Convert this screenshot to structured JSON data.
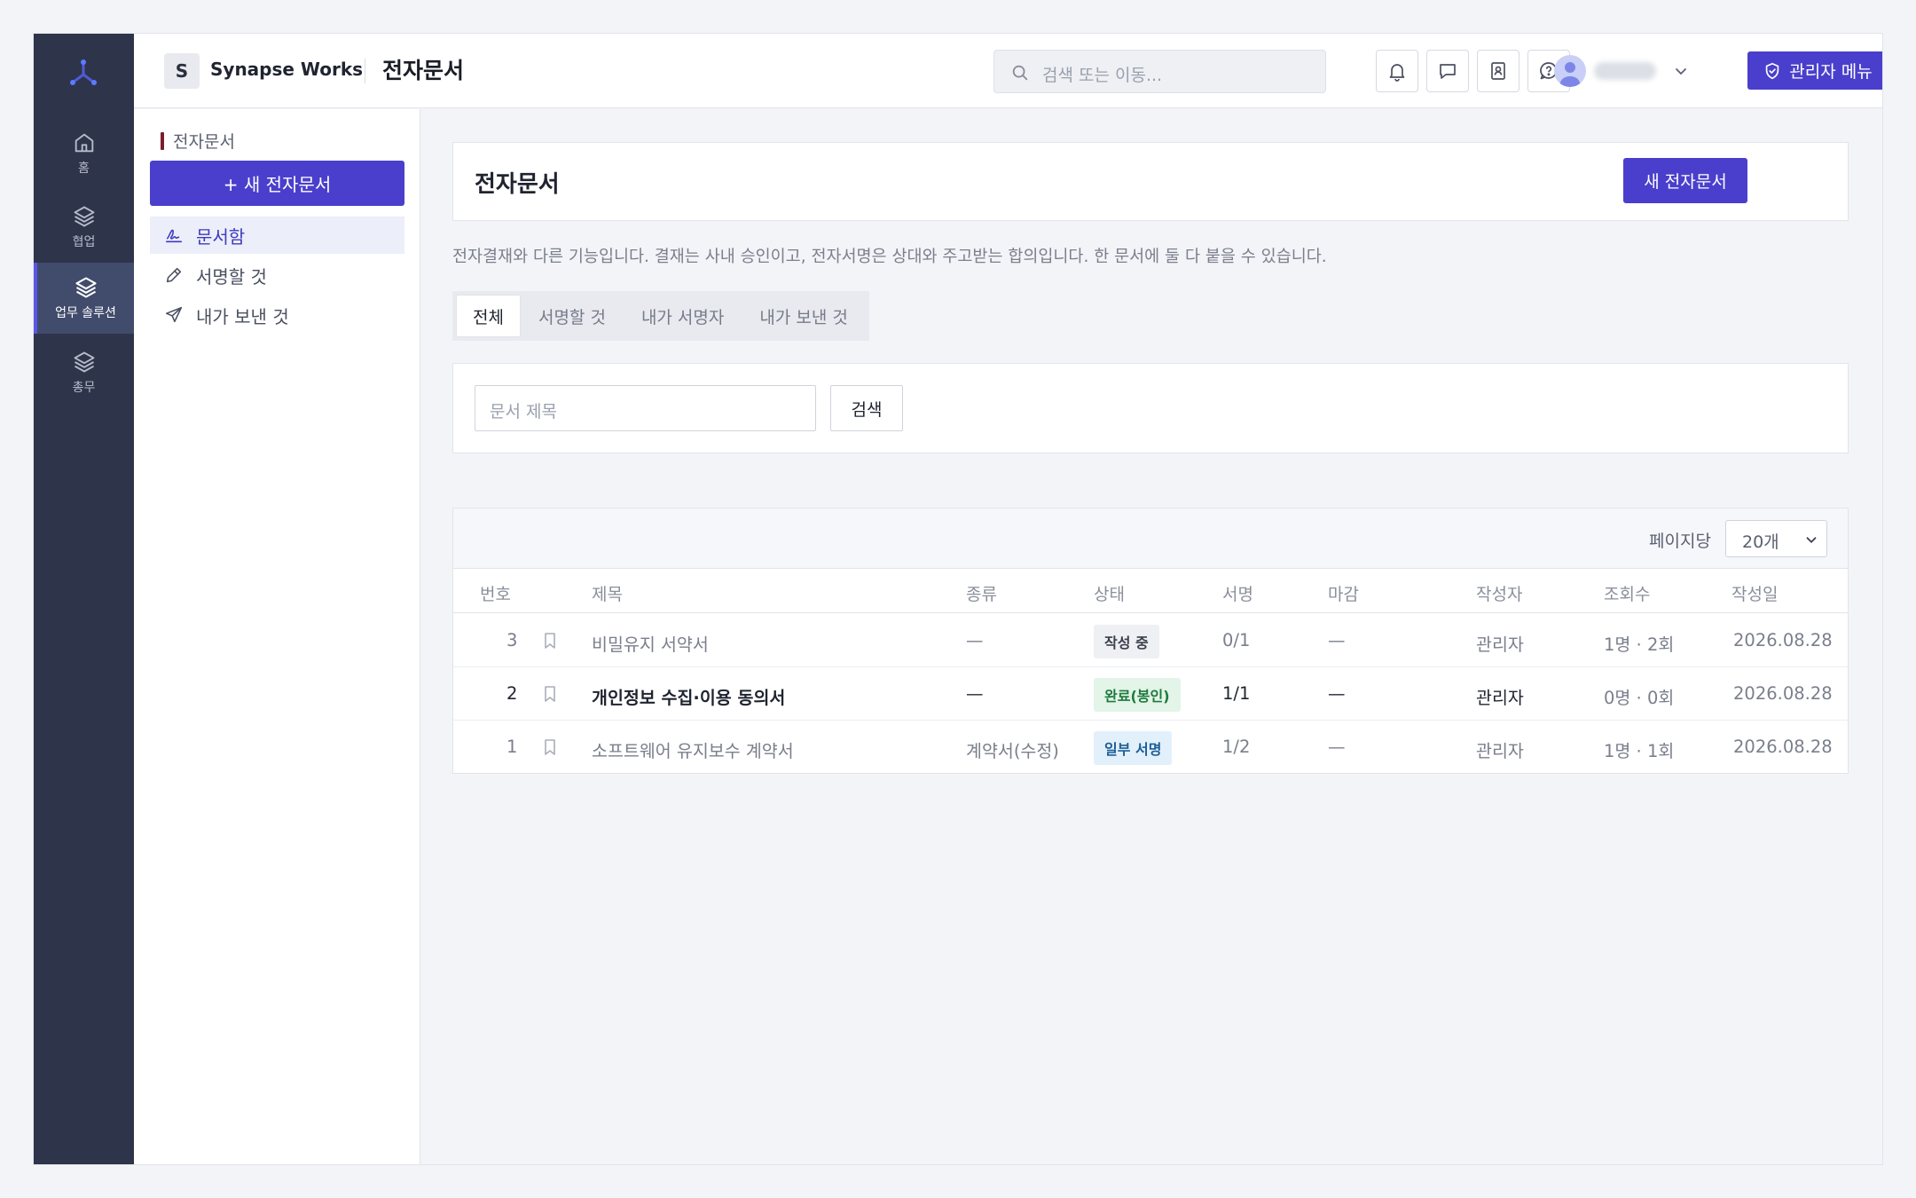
{
  "rail": {
    "items": [
      {
        "label": "홈",
        "icon": "home-icon"
      },
      {
        "label": "협업",
        "icon": "layers-icon"
      },
      {
        "label": "업무 솔루션",
        "icon": "layers-icon"
      },
      {
        "label": "총무",
        "icon": "layers-icon"
      }
    ]
  },
  "topbar": {
    "brand_initial": "S",
    "brand_name": "Synapse Works",
    "page_title": "전자문서",
    "search_placeholder": "검색 또는 이동...",
    "icons": [
      "bell-icon",
      "chat-icon",
      "contacts-icon",
      "help-icon"
    ],
    "admin_label": "관리자 메뉴"
  },
  "sidebar": {
    "section_title": "전자문서",
    "new_button": "+ 새 전자문서",
    "items": [
      {
        "label": "문서함",
        "icon": "signature-icon"
      },
      {
        "label": "서명할 것",
        "icon": "pen-icon"
      },
      {
        "label": "내가 보낸 것",
        "icon": "send-icon"
      }
    ]
  },
  "main": {
    "title": "전자문서",
    "new_button": "새 전자문서",
    "description": "전자결재와 다른 기능입니다. 결재는 사내 승인이고, 전자서명은 상대와 주고받는 합의입니다. 한 문서에 둘 다 붙을 수 있습니다.",
    "tabs": [
      "전체",
      "서명할 것",
      "내가 서명자",
      "내가 보낸 것"
    ],
    "filter": {
      "placeholder": "문서 제목",
      "search_button": "검색"
    },
    "per_page_label": "페이지당",
    "per_page_value": "20개",
    "columns": [
      "번호",
      "제목",
      "종류",
      "상태",
      "서명",
      "마감",
      "작성자",
      "조회수",
      "작성일"
    ],
    "rows": [
      {
        "no": "3",
        "title": "비밀유지 서약서",
        "kind": "—",
        "status": "작성 중",
        "sign": "0/1",
        "due": "—",
        "author": "관리자",
        "views": "1명 · 2회",
        "date": "2026.08.28"
      },
      {
        "no": "2",
        "title": "개인정보 수집·이용 동의서",
        "kind": "—",
        "status": "완료(봉인)",
        "sign": "1/1",
        "due": "—",
        "author": "관리자",
        "views": "0명 · 0회",
        "date": "2026.08.28"
      },
      {
        "no": "1",
        "title": "소프트웨어 유지보수 계약서",
        "kind": "계약서(수정)",
        "status": "일부 서명",
        "sign": "1/2",
        "due": "—",
        "author": "관리자",
        "views": "1명 · 1회",
        "date": "2026.08.28"
      }
    ]
  },
  "colors": {
    "accent": "#4a3fcc",
    "rail_bg": "#2e344a",
    "badge_draft_bg": "#eef0f3",
    "badge_done_bg": "#e3f4e8",
    "badge_done_text": "#1e7a3c",
    "badge_partial_bg": "#e2f0fb",
    "badge_partial_text": "#1d5e96"
  }
}
